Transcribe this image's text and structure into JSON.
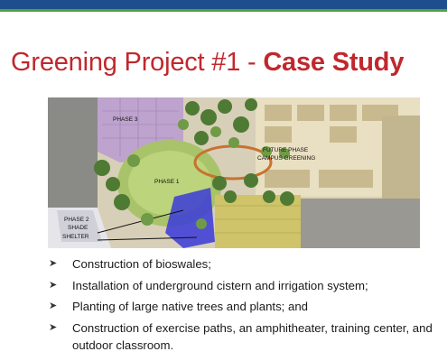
{
  "slide": {
    "title_prefix": "Greening Project #1 - ",
    "title_emphasis": "Case Study"
  },
  "site_plan": {
    "labels": {
      "phase3": "PHASE 3",
      "phase1": "PHASE 1",
      "future_line1": "FUTURE PHASE",
      "future_line2": "CAMPUS GREENING",
      "phase2_line1": "PHASE 2",
      "phase2_line2": "SHADE",
      "phase2_line3": "SHELTER"
    }
  },
  "bullets": [
    "Construction of bioswales;",
    "Installation of underground cistern and irrigation system;",
    "Planting of large native trees and plants; and",
    "Construction of exercise paths, an amphitheater, training center, and outdoor classroom."
  ],
  "colors": {
    "title": "#c0282d",
    "top_bar": "#1f4e8c",
    "accent": "#4fa23a"
  },
  "icons": {
    "bullet": "arrowhead-bullet-icon"
  }
}
